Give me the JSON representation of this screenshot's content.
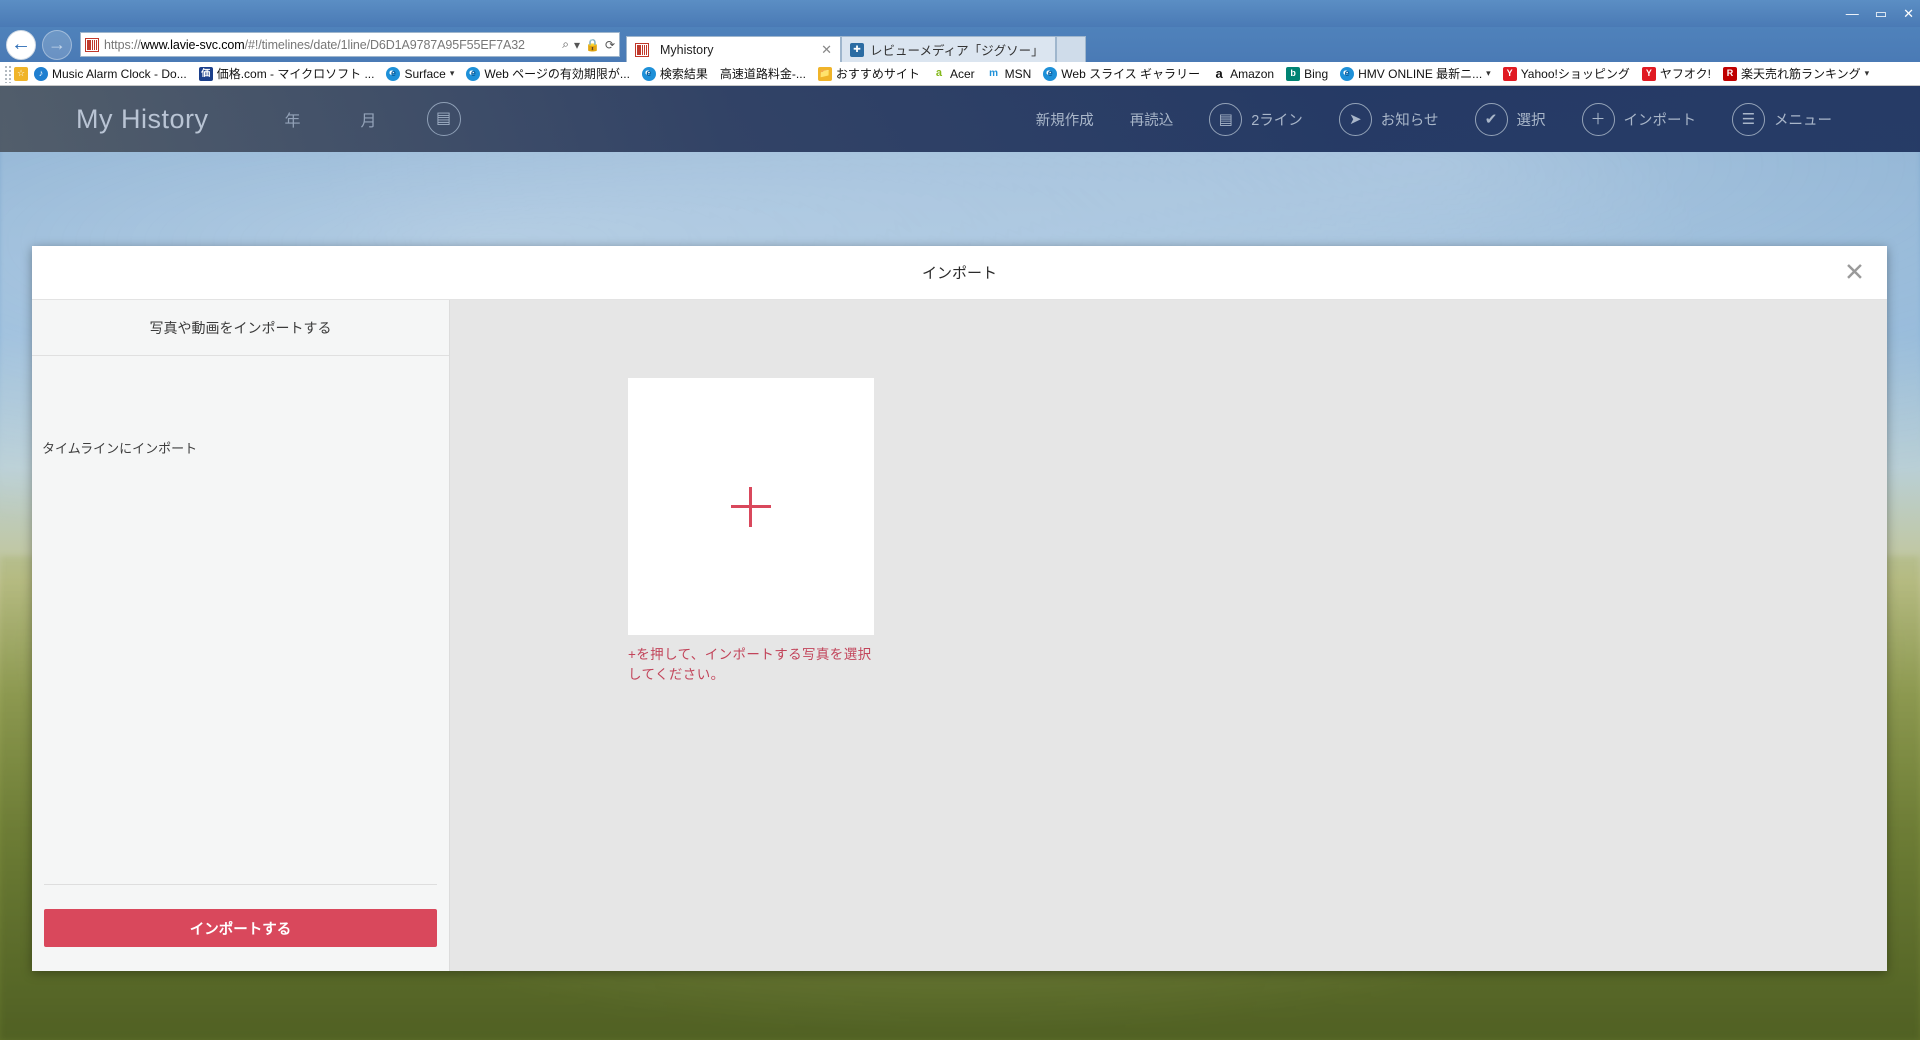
{
  "window": {
    "controls": {
      "minimize": "—",
      "maximize": "▭",
      "close": "✕"
    }
  },
  "browser": {
    "back_icon": "←",
    "forward_icon": "→",
    "address": {
      "scheme": "https://",
      "host": "www.lavie-svc.com",
      "path": "/#!/timelines/date/1line/D6D1A9787A95F55EF7A32",
      "full": "https://www.lavie-svc.com/#!/timelines/date/1line/D6D1A9787A95F55EF7A32",
      "search_icon": "⌕",
      "dropdown_icon": "▾",
      "lock_icon": "🔒",
      "refresh_icon": "⟳"
    },
    "tabs": [
      {
        "title": "Myhistory",
        "close": "✕",
        "active": true
      },
      {
        "title": "レビューメディア「ジグソー」",
        "close": "",
        "active": false
      }
    ],
    "toolbar_right": {
      "home_icon": "⌂",
      "favorites_icon": "★",
      "settings_icon": "⚙"
    }
  },
  "favorites": [
    {
      "label": "Music Alarm Clock - Do...",
      "icon": "alarm-icon",
      "caret": ""
    },
    {
      "label": "価格.com - マイクロソフト ...",
      "icon": "kakaku-icon",
      "caret": ""
    },
    {
      "label": "Surface",
      "icon": "ie-icon",
      "caret": "▾"
    },
    {
      "label": "Web ページの有効期限が...",
      "icon": "ie-icon",
      "caret": ""
    },
    {
      "label": "検索結果　高速道路料金-...",
      "icon": "ie-icon",
      "caret": ""
    },
    {
      "label": "おすすめサイト",
      "icon": "folder-icon",
      "caret": ""
    },
    {
      "label": "Acer",
      "icon": "acer-icon",
      "caret": ""
    },
    {
      "label": "MSN",
      "icon": "msn-icon",
      "caret": ""
    },
    {
      "label": "Web スライス ギャラリー",
      "icon": "ie-icon",
      "caret": ""
    },
    {
      "label": "Amazon",
      "icon": "amazon-icon",
      "caret": ""
    },
    {
      "label": "Bing",
      "icon": "bing-icon",
      "caret": ""
    },
    {
      "label": "HMV ONLINE 最新ニ...",
      "icon": "ie-icon",
      "caret": "▾"
    },
    {
      "label": "Yahoo!ショッピング",
      "icon": "yahoo-icon",
      "caret": ""
    },
    {
      "label": "ヤフオク!",
      "icon": "yahoo-icon",
      "caret": ""
    },
    {
      "label": "楽天売れ筋ランキング",
      "icon": "rakuten-icon",
      "caret": "▾"
    }
  ],
  "app": {
    "title": "My History",
    "left_nav": [
      {
        "label": "年"
      },
      {
        "label": "月"
      }
    ],
    "line_toggle_icon": "▤",
    "right_nav": [
      {
        "label": "新規作成",
        "icon": ""
      },
      {
        "label": "再読込",
        "icon": ""
      },
      {
        "label": "2ライン",
        "icon": "lines-icon",
        "glyph": "▤"
      },
      {
        "label": "お知らせ",
        "icon": "paper-plane-icon",
        "glyph": "➤"
      },
      {
        "label": "選択",
        "icon": "check-icon",
        "glyph": "✔"
      },
      {
        "label": "インポート",
        "icon": "plus-icon",
        "glyph": "＋"
      },
      {
        "label": "メニュー",
        "icon": "list-icon",
        "glyph": "☰"
      }
    ]
  },
  "dialog": {
    "title": "インポート",
    "close_icon": "✕",
    "sidebar": {
      "header": "写真や動画をインポートする",
      "section_label": "タイムラインにインポート",
      "submit_label": "インポートする"
    },
    "main": {
      "plus_icon": "plus-icon",
      "hint": "+を押して、インポートする写真を選択してください。"
    }
  },
  "colors": {
    "accent_red": "#d9485c",
    "hint_red": "#c2445a",
    "chrome_blue": "#4a7ab5",
    "app_header": "#1c305c"
  }
}
